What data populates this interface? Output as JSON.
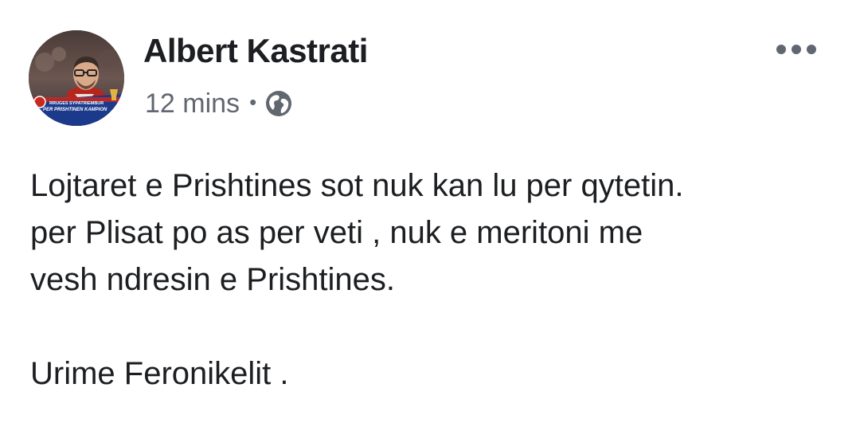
{
  "post": {
    "author": "Albert Kastrati",
    "timestamp": "12 mins",
    "separator": "•",
    "privacy_icon": "globe-icon",
    "more_icon": "more-options-icon",
    "avatar_caption_top": "RRUGES SYPATRIEMBUR",
    "avatar_caption_bottom": "PER PRISHTINEN KAMPION",
    "text_lines": [
      "Lojtaret e Prishtines sot nuk kan lu per qytetin.",
      "per Plisat po as per veti , nuk e meritoni me",
      "vesh ndresin e Prishtines."
    ],
    "closing_line": "Urime Feronikelit ."
  },
  "colors": {
    "name": "#1c1e21",
    "meta": "#606770",
    "body_text": "#1c1e21",
    "avatar_band": "#1b3a8c",
    "avatar_accent": "#c8281e"
  }
}
